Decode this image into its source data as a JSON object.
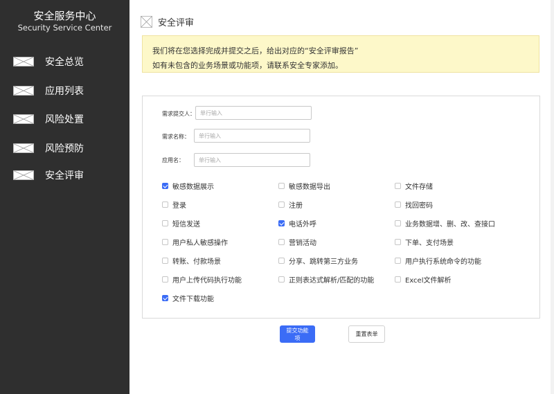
{
  "sidebar": {
    "brand_cn": "安全服务中心",
    "brand_en": "Security Service Center",
    "items": [
      {
        "label": "安全总览",
        "icon": "image-placeholder-icon"
      },
      {
        "label": "应用列表",
        "icon": "image-placeholder-icon"
      },
      {
        "label": "风险处置",
        "icon": "image-placeholder-icon"
      },
      {
        "label": "风险预防",
        "icon": "image-placeholder-icon"
      },
      {
        "label": "安全评审",
        "icon": "image-placeholder-icon"
      }
    ]
  },
  "header": {
    "title": "安全评审",
    "icon": "image-placeholder-icon"
  },
  "notice": {
    "line1": "我们将在您选择完成并提交之后，给出对应的“安全评审报告”",
    "line2": "如有未包含的业务场景或功能项，请联系安全专家添加。"
  },
  "form": {
    "fields": [
      {
        "label": "需求提交人：",
        "placeholder": "单行输入",
        "value": ""
      },
      {
        "label": "需求名称：",
        "placeholder": "单行输入",
        "value": ""
      },
      {
        "label": "应用名：",
        "placeholder": "单行输入",
        "value": ""
      }
    ],
    "options": [
      {
        "label": "敏感数据展示",
        "checked": true
      },
      {
        "label": "敏感数据导出",
        "checked": false
      },
      {
        "label": "文件存储",
        "checked": false
      },
      {
        "label": "登录",
        "checked": false
      },
      {
        "label": "注册",
        "checked": false
      },
      {
        "label": "找回密码",
        "checked": false
      },
      {
        "label": "短信发送",
        "checked": false
      },
      {
        "label": "电话外呼",
        "checked": true
      },
      {
        "label": "业务数据增、删、改、查接口",
        "checked": false
      },
      {
        "label": "用户私人敏感操作",
        "checked": false
      },
      {
        "label": "营销活动",
        "checked": false
      },
      {
        "label": "下单、支付场景",
        "checked": false
      },
      {
        "label": "转账、付款场景",
        "checked": false
      },
      {
        "label": "分享、跳转第三方业务",
        "checked": false
      },
      {
        "label": "用户执行系统命令的功能",
        "checked": false
      },
      {
        "label": "用户上传代码执行功能",
        "checked": false
      },
      {
        "label": "正则表达式解析/匹配的功能",
        "checked": false
      },
      {
        "label": "Excel文件解析",
        "checked": false
      },
      {
        "label": "文件下载功能",
        "checked": true
      }
    ]
  },
  "actions": {
    "submit_label": "提交功能项",
    "reset_label": "重置表单"
  },
  "colors": {
    "sidebar_bg": "#2f2f2f",
    "accent": "#3b6cf6",
    "notice_bg": "#fdf8c9"
  }
}
